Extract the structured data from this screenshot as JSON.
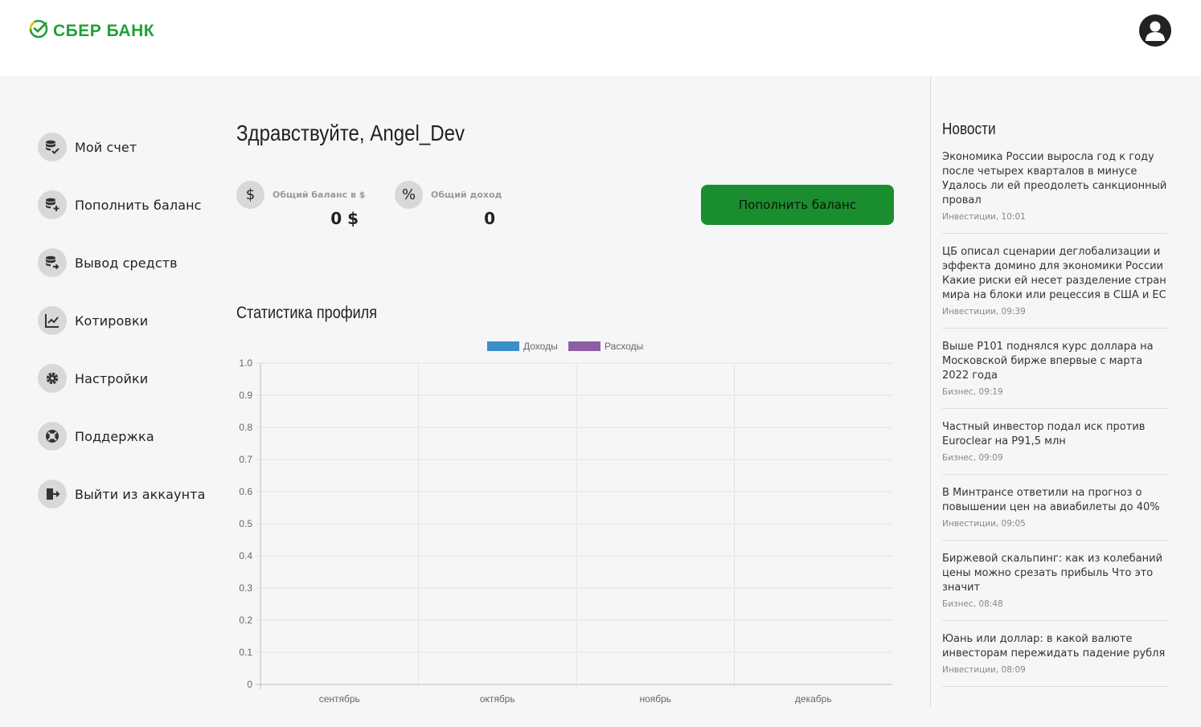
{
  "header": {
    "logo_text": "СБЕР БАНК",
    "brand_color": "#21a038"
  },
  "sidebar": {
    "items": [
      {
        "label": "Мой счет",
        "icon": "coins-check-icon"
      },
      {
        "label": "Пополнить баланс",
        "icon": "coins-plus-icon"
      },
      {
        "label": "Вывод средств",
        "icon": "coins-arrow-icon"
      },
      {
        "label": "Котировки",
        "icon": "chart-line-icon"
      },
      {
        "label": "Настройки",
        "icon": "gear-icon"
      },
      {
        "label": "Поддержка",
        "icon": "lifebuoy-icon"
      },
      {
        "label": "Выйти из аккаунта",
        "icon": "logout-icon"
      }
    ]
  },
  "main": {
    "greeting": "Здравствуйте, Angel_Dev",
    "balance": {
      "icon": "$",
      "label": "Общий баланс в $",
      "value": "0 $"
    },
    "income": {
      "icon": "%",
      "label": "Общий доход",
      "value": "0"
    },
    "topup_button": "Пополнить баланс",
    "stats_title": "Статистика профиля"
  },
  "chart_data": {
    "type": "bar",
    "categories": [
      "сентябрь",
      "октябрь",
      "ноябрь",
      "декабрь"
    ],
    "series": [
      {
        "name": "Доходы",
        "values": [
          0,
          0,
          0,
          0
        ],
        "color": "#3b8fc9"
      },
      {
        "name": "Расходы",
        "values": [
          0,
          0,
          0,
          0
        ],
        "color": "#8e5ea2"
      }
    ],
    "yticks": [
      "0",
      "0.1",
      "0.2",
      "0.3",
      "0.4",
      "0.5",
      "0.6",
      "0.7",
      "0.8",
      "0.9",
      "1.0"
    ],
    "ylim": [
      0,
      1.0
    ],
    "grid": true,
    "legend": "top"
  },
  "news": {
    "title": "Новости",
    "items": [
      {
        "text": "Экономика России выросла год к году после четырех кварталов в минусе Удалось ли ей преодолеть санкционный провал",
        "meta": "Инвестиции, 10:01"
      },
      {
        "text": "ЦБ описал сценарии деглобализации и эффекта домино для экономики России Какие риски ей несет разделение стран мира на блоки или рецессия в США и ЕС",
        "meta": "Инвестиции, 09:39"
      },
      {
        "text": "Выше Р101 поднялся курс доллара на Московской бирже впервые с марта 2022 года",
        "meta": "Бизнес, 09:19"
      },
      {
        "text": "Частный инвестор подал иск против Euroclear на Р91,5 млн",
        "meta": "Бизнес, 09:09"
      },
      {
        "text": "В Минтрансе ответили на прогноз о повышении цен на авиабилеты до 40%",
        "meta": "Инвестиции, 09:05"
      },
      {
        "text": "Биржевой скальпинг: как из колебаний цены можно срезать прибыль Что это значит",
        "meta": "Бизнес, 08:48"
      },
      {
        "text": "Юань или доллар: в какой валюте инвесторам пережидать падение рубля",
        "meta": "Инвестиции, 08:09"
      }
    ]
  }
}
